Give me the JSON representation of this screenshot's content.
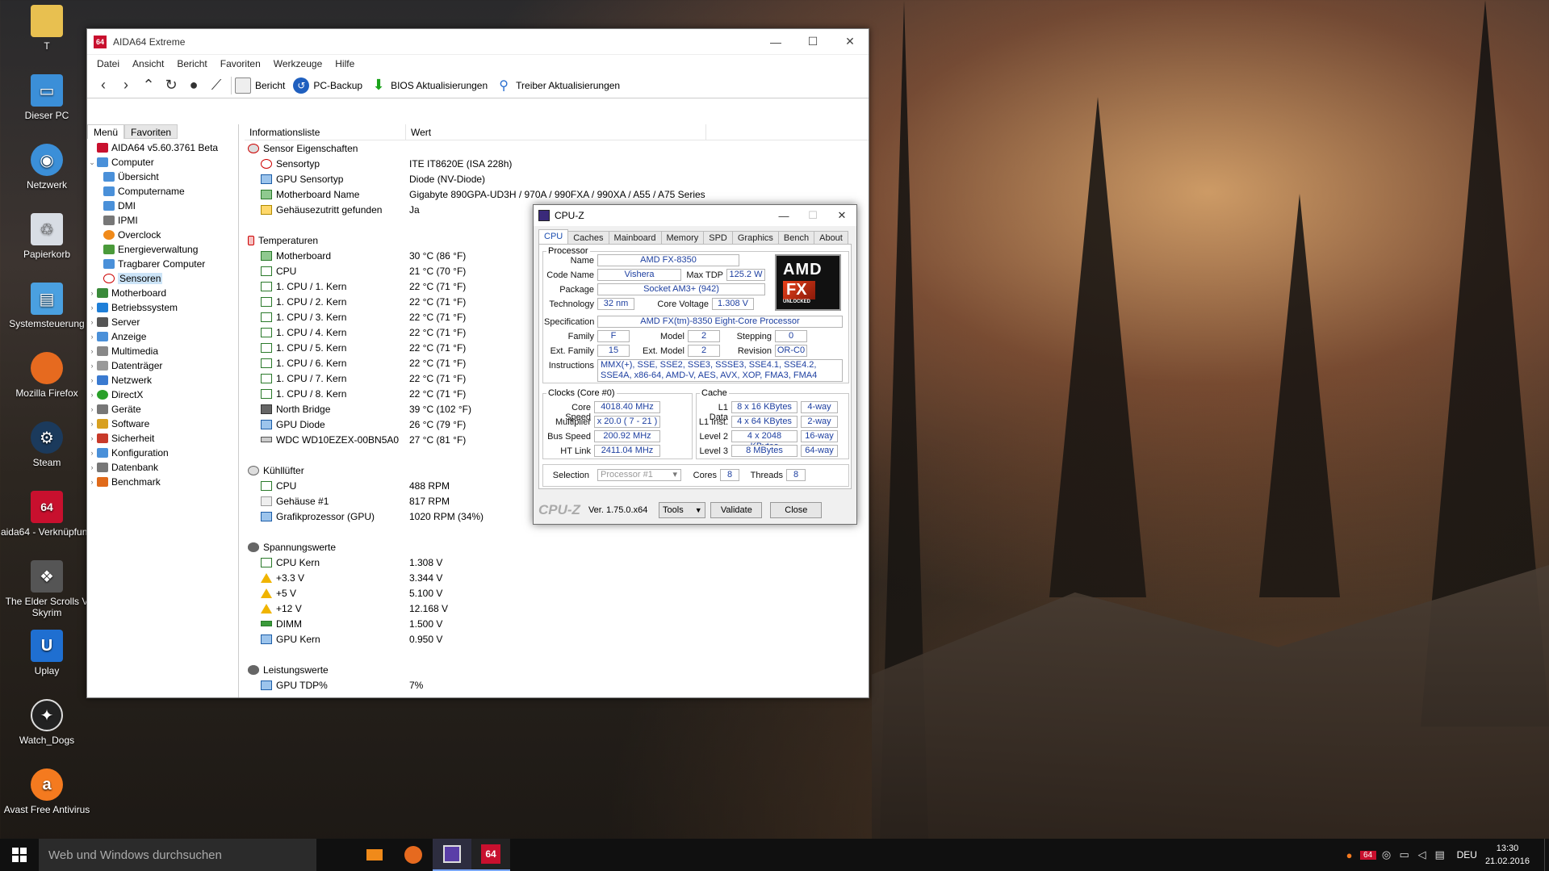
{
  "desktop": {
    "icons": [
      {
        "label": "T"
      },
      {
        "label": "Dieser PC"
      },
      {
        "label": "Netzwerk"
      },
      {
        "label": "Papierkorb"
      },
      {
        "label": "Systemsteuerung"
      },
      {
        "label": "Mozilla Firefox"
      },
      {
        "label": "Steam"
      },
      {
        "label": "aida64 - Verknüpfung"
      },
      {
        "label": "The Elder Scrolls V Skyrim"
      },
      {
        "label": "Uplay"
      },
      {
        "label": "Watch_Dogs"
      },
      {
        "label": "Avast Free Antivirus"
      }
    ]
  },
  "aida": {
    "title": "AIDA64 Extreme",
    "icon_text": "64",
    "menu": [
      "Datei",
      "Ansicht",
      "Bericht",
      "Favoriten",
      "Werkzeuge",
      "Hilfe"
    ],
    "toolbar": {
      "report": "Bericht",
      "backup": "PC-Backup",
      "bios": "BIOS Aktualisierungen",
      "driver": "Treiber Aktualisierungen"
    },
    "tabs": {
      "menu": "Menü",
      "favorites": "Favoriten"
    },
    "tree": {
      "root": "AIDA64 v5.60.3761 Beta",
      "computer": "Computer",
      "children": [
        "Übersicht",
        "Computername",
        "DMI",
        "IPMI",
        "Overclock",
        "Energieverwaltung",
        "Tragbarer Computer",
        "Sensoren"
      ],
      "sections": [
        "Motherboard",
        "Betriebssystem",
        "Server",
        "Anzeige",
        "Multimedia",
        "Datenträger",
        "Netzwerk",
        "DirectX",
        "Geräte",
        "Software",
        "Sicherheit",
        "Konfiguration",
        "Datenbank",
        "Benchmark"
      ]
    },
    "columns": {
      "info": "Informationsliste",
      "value": "Wert"
    },
    "groups": {
      "props": {
        "title": "Sensor Eigenschaften",
        "rows": [
          {
            "name": "Sensortyp",
            "value": "ITE IT8620E  (ISA 228h)"
          },
          {
            "name": "GPU Sensortyp",
            "value": "Diode  (NV-Diode)"
          },
          {
            "name": "Motherboard Name",
            "value": "Gigabyte 890GPA-UD3H / 970A / 990FXA / 990XA / A55 / A75 Series"
          },
          {
            "name": "Gehäusezutritt gefunden",
            "value": "Ja"
          }
        ]
      },
      "temps": {
        "title": "Temperaturen",
        "rows": [
          {
            "name": "Motherboard",
            "value": "30 °C  (86 °F)"
          },
          {
            "name": "CPU",
            "value": "21 °C  (70 °F)"
          },
          {
            "name": "1. CPU / 1. Kern",
            "value": "22 °C  (71 °F)"
          },
          {
            "name": "1. CPU / 2. Kern",
            "value": "22 °C  (71 °F)"
          },
          {
            "name": "1. CPU / 3. Kern",
            "value": "22 °C  (71 °F)"
          },
          {
            "name": "1. CPU / 4. Kern",
            "value": "22 °C  (71 °F)"
          },
          {
            "name": "1. CPU / 5. Kern",
            "value": "22 °C  (71 °F)"
          },
          {
            "name": "1. CPU / 6. Kern",
            "value": "22 °C  (71 °F)"
          },
          {
            "name": "1. CPU / 7. Kern",
            "value": "22 °C  (71 °F)"
          },
          {
            "name": "1. CPU / 8. Kern",
            "value": "22 °C  (71 °F)"
          },
          {
            "name": "North Bridge",
            "value": "39 °C  (102 °F)"
          },
          {
            "name": "GPU Diode",
            "value": "26 °C  (79 °F)"
          },
          {
            "name": "WDC WD10EZEX-00BN5A0",
            "value": "27 °C  (81 °F)"
          }
        ]
      },
      "fans": {
        "title": "Kühllüfter",
        "rows": [
          {
            "name": "CPU",
            "value": "488 RPM"
          },
          {
            "name": "Gehäuse #1",
            "value": "817 RPM"
          },
          {
            "name": "Grafikprozessor (GPU)",
            "value": "1020 RPM  (34%)"
          }
        ]
      },
      "volts": {
        "title": "Spannungswerte",
        "rows": [
          {
            "name": "CPU Kern",
            "value": "1.308 V"
          },
          {
            "name": "+3.3 V",
            "value": "3.344 V"
          },
          {
            "name": "+5 V",
            "value": "5.100 V"
          },
          {
            "name": "+12 V",
            "value": "12.168 V"
          },
          {
            "name": "DIMM",
            "value": "1.500 V"
          },
          {
            "name": "GPU Kern",
            "value": "0.950 V"
          }
        ]
      },
      "power": {
        "title": "Leistungswerte",
        "rows": [
          {
            "name": "GPU TDP%",
            "value": "7%"
          }
        ]
      }
    }
  },
  "cpuz": {
    "title": "CPU-Z",
    "tabs": [
      "CPU",
      "Caches",
      "Mainboard",
      "Memory",
      "SPD",
      "Graphics",
      "Bench",
      "About"
    ],
    "processor_legend": "Processor",
    "labels": {
      "name": "Name",
      "codename": "Code Name",
      "maxtdp": "Max TDP",
      "package": "Package",
      "technology": "Technology",
      "corevoltage": "Core Voltage",
      "spec": "Specification",
      "family": "Family",
      "model": "Model",
      "stepping": "Stepping",
      "extfamily": "Ext. Family",
      "extmodel": "Ext. Model",
      "revision": "Revision",
      "instructions": "Instructions",
      "clocks_legend": "Clocks (Core #0)",
      "cache_legend": "Cache",
      "corespeed": "Core Speed",
      "multiplier": "Multiplier",
      "busspeed": "Bus Speed",
      "htlink": "HT Link",
      "l1data": "L1 Data",
      "l1inst": "L1 Inst.",
      "level2": "Level 2",
      "level3": "Level 3",
      "selection": "Selection",
      "cores": "Cores",
      "threads": "Threads"
    },
    "values": {
      "name": "AMD FX-8350",
      "codename": "Vishera",
      "maxtdp": "125.2 W",
      "package": "Socket AM3+ (942)",
      "technology": "32 nm",
      "corevoltage": "1.308 V",
      "spec": "AMD FX(tm)-8350 Eight-Core Processor",
      "family": "F",
      "model": "2",
      "stepping": "0",
      "extfamily": "15",
      "extmodel": "2",
      "revision": "OR-C0",
      "instructions": "MMX(+), SSE, SSE2, SSE3, SSSE3, SSE4.1, SSE4.2, SSE4A, x86-64, AMD-V, AES, AVX, XOP, FMA3, FMA4",
      "corespeed": "4018.40 MHz",
      "multiplier": "x 20.0 ( 7 - 21 )",
      "busspeed": "200.92 MHz",
      "htlink": "2411.04 MHz",
      "l1data": "8 x 16 KBytes",
      "l1data_way": "4-way",
      "l1inst": "4 x 64 KBytes",
      "l1inst_way": "2-way",
      "level2": "4 x 2048 KBytes",
      "level2_way": "16-way",
      "level3": "8 MBytes",
      "level3_way": "64-way",
      "selection": "Processor #1",
      "cores": "8",
      "threads": "8"
    },
    "logo": {
      "amd": "AMD",
      "fx": "FX",
      "sub": "UNLOCKED"
    },
    "footer": {
      "brand": "CPU-Z",
      "version": "Ver. 1.75.0.x64",
      "tools": "Tools",
      "validate": "Validate",
      "close": "Close"
    }
  },
  "taskbar": {
    "search_placeholder": "Web und Windows durchsuchen",
    "lang": "DEU",
    "time": "13:30",
    "date": "21.02.2016",
    "aida_badge": "64"
  }
}
